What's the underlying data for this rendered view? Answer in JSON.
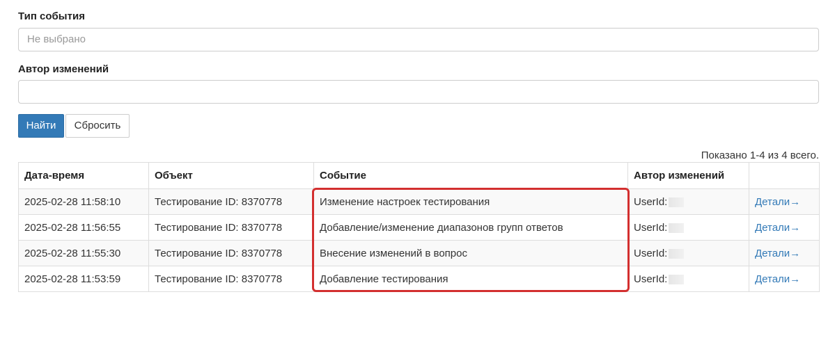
{
  "filters": {
    "event_type_label": "Тип события",
    "event_type_value": "Не выбрано",
    "author_label": "Автор изменений",
    "author_value": ""
  },
  "buttons": {
    "find": "Найти",
    "reset": "Сбросить"
  },
  "summary": "Показано 1-4 из 4 всего.",
  "table": {
    "headers": [
      "Дата-время",
      "Объект",
      "Событие",
      "Автор изменений",
      ""
    ],
    "rows": [
      {
        "datetime": "2025-02-28 11:58:10",
        "object": "Тестирование ID: 8370778",
        "event": "Изменение настроек тестирования",
        "author": "UserId:",
        "details": "Детали→"
      },
      {
        "datetime": "2025-02-28 11:56:55",
        "object": "Тестирование ID: 8370778",
        "event": "Добавление/изменение диапазонов групп ответов",
        "author": "UserId:",
        "details": "Детали→"
      },
      {
        "datetime": "2025-02-28 11:55:30",
        "object": "Тестирование ID: 8370778",
        "event": "Внесение изменений в вопрос",
        "author": "UserId:",
        "details": "Детали→"
      },
      {
        "datetime": "2025-02-28 11:53:59",
        "object": "Тестирование ID: 8370778",
        "event": "Добавление тестирования",
        "author": "UserId:",
        "details": "Детали→"
      }
    ]
  },
  "colors": {
    "primary": "#337ab7",
    "highlight": "#d32f2f",
    "link": "#337ab7"
  }
}
